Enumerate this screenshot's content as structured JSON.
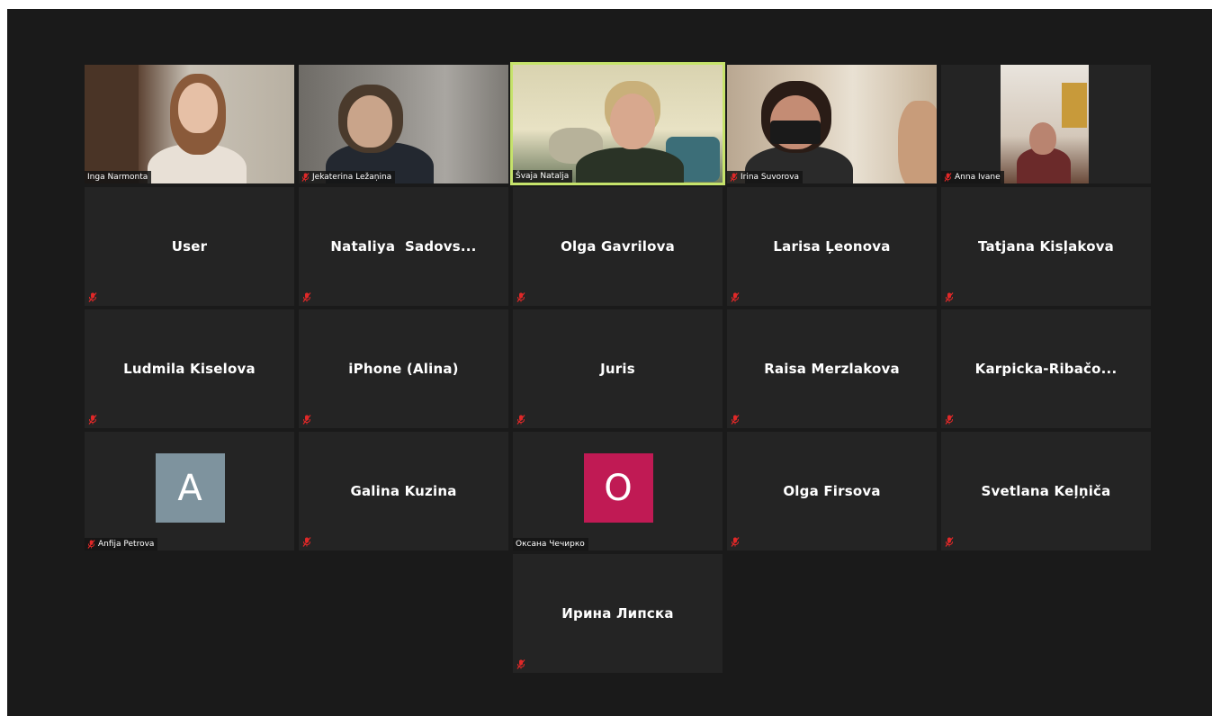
{
  "colors": {
    "background": "#1a1a1a",
    "tile": "#242424",
    "active_speaker_border": "#c6e36b",
    "muted_mic": "#e02828",
    "avatar_a": "#7e939e",
    "avatar_o": "#c01a54"
  },
  "video_tiles": [
    {
      "name": "Inga Narmonta",
      "muted": false
    },
    {
      "name": "Jekaterina Ležaņina",
      "muted": true
    },
    {
      "name": "Švaja Natalja",
      "muted": false,
      "active_speaker": true
    },
    {
      "name": "Irina Suvorova",
      "muted": true
    },
    {
      "name": "Anna Ivane",
      "muted": true
    }
  ],
  "name_tiles": [
    {
      "name": "User"
    },
    {
      "name": "Nataliya  Sadovs..."
    },
    {
      "name": "Olga Gavrilova"
    },
    {
      "name": "Larisa Ļeonova"
    },
    {
      "name": "Tatjana Kisļakova"
    },
    {
      "name": "Ludmila Kiselova"
    },
    {
      "name": "iPhone (Alina)"
    },
    {
      "name": "Juris"
    },
    {
      "name": "Raisa Merzlakova"
    },
    {
      "name": "Karpicka-Ribačo..."
    },
    {
      "name": "Galina Kuzina"
    },
    {
      "name": "Olga Firsova"
    },
    {
      "name": "Svetlana Keļņiča"
    },
    {
      "name": "Ирина Липска"
    }
  ],
  "avatar_tiles": [
    {
      "initial": "A",
      "name": "Anfija Petrova",
      "muted": true
    },
    {
      "initial": "O",
      "name": "Оксана Чечирко",
      "muted": false
    }
  ],
  "icons": {
    "muted": "microphone-muted-icon"
  }
}
